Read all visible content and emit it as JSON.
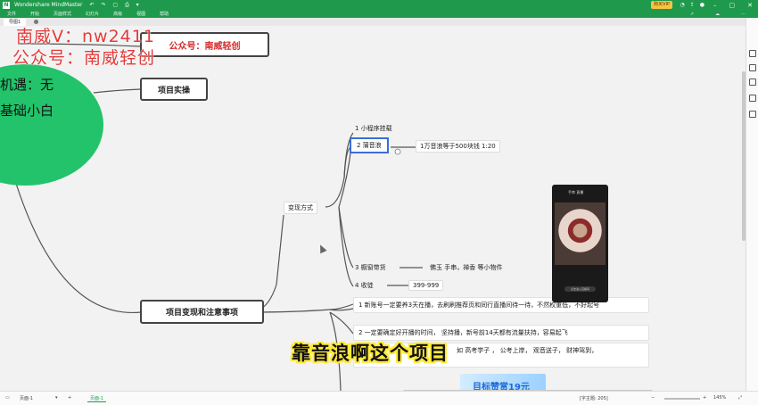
{
  "app": {
    "title": "Wondershare MindMaster",
    "logo": "N",
    "quick_access": "↶ ↷ ▢ ⎙ ▾",
    "premium_label": "购买VIP"
  },
  "menu": [
    "文件",
    "开始",
    "页面样式",
    "幻灯片",
    "高级",
    "视图",
    "帮助"
  ],
  "menu_tools": [
    "↗",
    "☁",
    "⋯"
  ],
  "window_controls": [
    "–",
    "▢",
    "✕"
  ],
  "doc_tab": "导图1",
  "watermark": {
    "line1": "南威V：nw2411",
    "line2": "公众号：南威轻创"
  },
  "nodes": {
    "gongzhonghao": "公众号：南威轻创",
    "xiangmu_shicao": "项目实操",
    "xiangmu_bianxian": "项目变现和注意事项",
    "bianxian_fangshi": "变现方式"
  },
  "green_node": {
    "line1": "机遇：无",
    "line2": "基础小白"
  },
  "subtopics": {
    "t1": "1 小程序挂载",
    "t2": "2 蒲音浪",
    "t2_detail": "1万音浪等于500块钱    1:20",
    "t3": "3 橱窗带货",
    "t3_detail": "佛玉   手串，禅香 等小物件",
    "t4": "4 收徒",
    "t4_detail": "399-999"
  },
  "notes": {
    "n1": "1 新账号一定要养3天在播，去刷刷推荐页和同行直播间待一待，不然权重低，不好起号",
    "n2": "2 一定要确定好开播的时间，  坚持播，新号前14天都有流量扶持，容易起飞",
    "n3": "如 高考学子 ，  公考上岸，  观音送子，  财神驾到，"
  },
  "phone": {
    "header": "手串    直播",
    "button": "点击进入直播间"
  },
  "subtitle": "靠音浪啊这个项目",
  "banner_text": "目标赞赏19元",
  "status": {
    "page": "页面-1",
    "add": "+",
    "active_page": "页面-1",
    "word_count": "[字主题: 205]",
    "zoom": "145%",
    "zoom_minus": "−",
    "zoom_plus": "+"
  },
  "colors": {
    "brand_green": "#1f9a4d",
    "blob_green": "#23c36b",
    "watermark_red": "#e23a3a",
    "selection_blue": "#3a6ed8",
    "subtitle_outline": "#ffe93a"
  },
  "icons": {
    "right_panel": [
      "format-icon",
      "style-icon",
      "outline-icon",
      "layers-icon",
      "note-icon"
    ]
  }
}
